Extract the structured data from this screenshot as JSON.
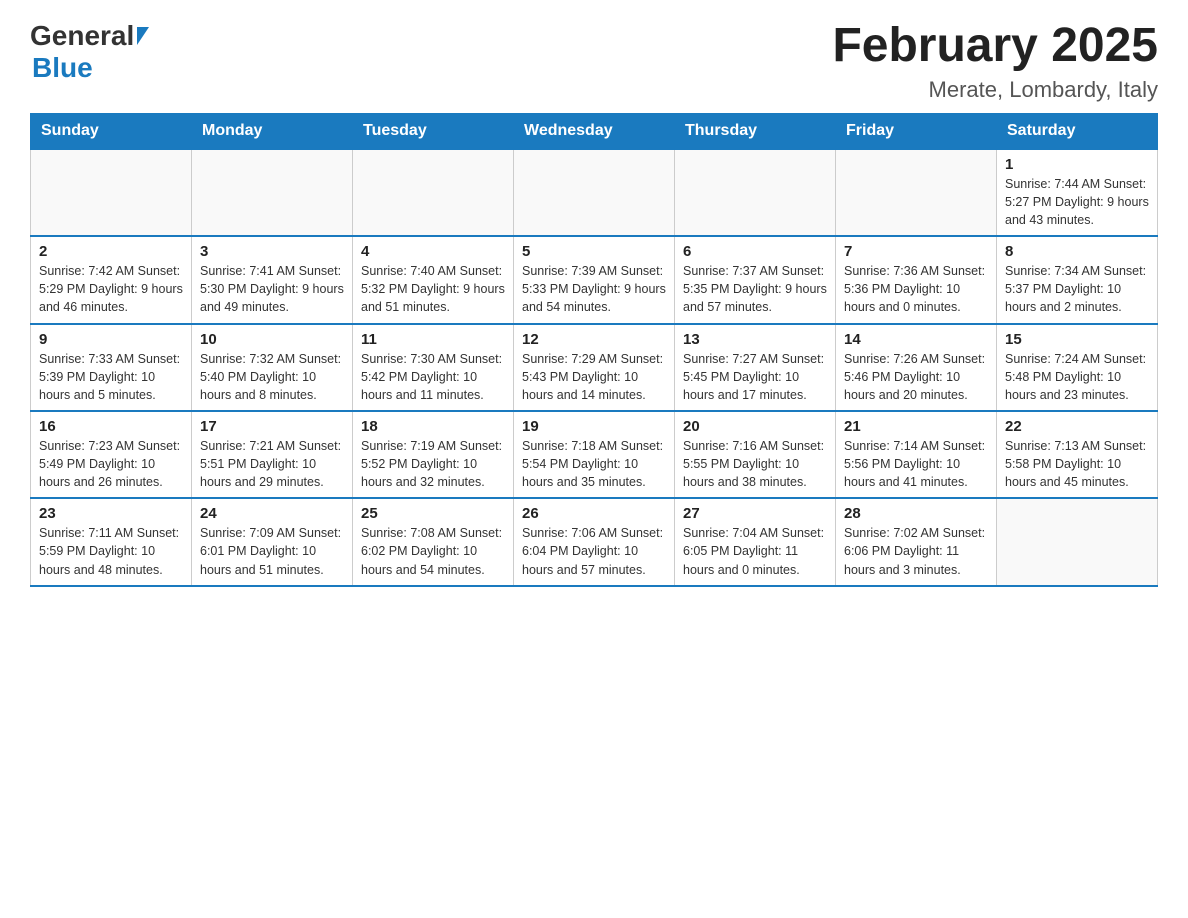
{
  "header": {
    "logo_general": "General",
    "logo_blue": "Blue",
    "title": "February 2025",
    "subtitle": "Merate, Lombardy, Italy"
  },
  "days_of_week": [
    "Sunday",
    "Monday",
    "Tuesday",
    "Wednesday",
    "Thursday",
    "Friday",
    "Saturday"
  ],
  "weeks": [
    {
      "days": [
        {
          "num": "",
          "info": "",
          "empty": true
        },
        {
          "num": "",
          "info": "",
          "empty": true
        },
        {
          "num": "",
          "info": "",
          "empty": true
        },
        {
          "num": "",
          "info": "",
          "empty": true
        },
        {
          "num": "",
          "info": "",
          "empty": true
        },
        {
          "num": "",
          "info": "",
          "empty": true
        },
        {
          "num": "1",
          "info": "Sunrise: 7:44 AM\nSunset: 5:27 PM\nDaylight: 9 hours\nand 43 minutes.",
          "empty": false
        }
      ]
    },
    {
      "days": [
        {
          "num": "2",
          "info": "Sunrise: 7:42 AM\nSunset: 5:29 PM\nDaylight: 9 hours\nand 46 minutes.",
          "empty": false
        },
        {
          "num": "3",
          "info": "Sunrise: 7:41 AM\nSunset: 5:30 PM\nDaylight: 9 hours\nand 49 minutes.",
          "empty": false
        },
        {
          "num": "4",
          "info": "Sunrise: 7:40 AM\nSunset: 5:32 PM\nDaylight: 9 hours\nand 51 minutes.",
          "empty": false
        },
        {
          "num": "5",
          "info": "Sunrise: 7:39 AM\nSunset: 5:33 PM\nDaylight: 9 hours\nand 54 minutes.",
          "empty": false
        },
        {
          "num": "6",
          "info": "Sunrise: 7:37 AM\nSunset: 5:35 PM\nDaylight: 9 hours\nand 57 minutes.",
          "empty": false
        },
        {
          "num": "7",
          "info": "Sunrise: 7:36 AM\nSunset: 5:36 PM\nDaylight: 10 hours\nand 0 minutes.",
          "empty": false
        },
        {
          "num": "8",
          "info": "Sunrise: 7:34 AM\nSunset: 5:37 PM\nDaylight: 10 hours\nand 2 minutes.",
          "empty": false
        }
      ]
    },
    {
      "days": [
        {
          "num": "9",
          "info": "Sunrise: 7:33 AM\nSunset: 5:39 PM\nDaylight: 10 hours\nand 5 minutes.",
          "empty": false
        },
        {
          "num": "10",
          "info": "Sunrise: 7:32 AM\nSunset: 5:40 PM\nDaylight: 10 hours\nand 8 minutes.",
          "empty": false
        },
        {
          "num": "11",
          "info": "Sunrise: 7:30 AM\nSunset: 5:42 PM\nDaylight: 10 hours\nand 11 minutes.",
          "empty": false
        },
        {
          "num": "12",
          "info": "Sunrise: 7:29 AM\nSunset: 5:43 PM\nDaylight: 10 hours\nand 14 minutes.",
          "empty": false
        },
        {
          "num": "13",
          "info": "Sunrise: 7:27 AM\nSunset: 5:45 PM\nDaylight: 10 hours\nand 17 minutes.",
          "empty": false
        },
        {
          "num": "14",
          "info": "Sunrise: 7:26 AM\nSunset: 5:46 PM\nDaylight: 10 hours\nand 20 minutes.",
          "empty": false
        },
        {
          "num": "15",
          "info": "Sunrise: 7:24 AM\nSunset: 5:48 PM\nDaylight: 10 hours\nand 23 minutes.",
          "empty": false
        }
      ]
    },
    {
      "days": [
        {
          "num": "16",
          "info": "Sunrise: 7:23 AM\nSunset: 5:49 PM\nDaylight: 10 hours\nand 26 minutes.",
          "empty": false
        },
        {
          "num": "17",
          "info": "Sunrise: 7:21 AM\nSunset: 5:51 PM\nDaylight: 10 hours\nand 29 minutes.",
          "empty": false
        },
        {
          "num": "18",
          "info": "Sunrise: 7:19 AM\nSunset: 5:52 PM\nDaylight: 10 hours\nand 32 minutes.",
          "empty": false
        },
        {
          "num": "19",
          "info": "Sunrise: 7:18 AM\nSunset: 5:54 PM\nDaylight: 10 hours\nand 35 minutes.",
          "empty": false
        },
        {
          "num": "20",
          "info": "Sunrise: 7:16 AM\nSunset: 5:55 PM\nDaylight: 10 hours\nand 38 minutes.",
          "empty": false
        },
        {
          "num": "21",
          "info": "Sunrise: 7:14 AM\nSunset: 5:56 PM\nDaylight: 10 hours\nand 41 minutes.",
          "empty": false
        },
        {
          "num": "22",
          "info": "Sunrise: 7:13 AM\nSunset: 5:58 PM\nDaylight: 10 hours\nand 45 minutes.",
          "empty": false
        }
      ]
    },
    {
      "days": [
        {
          "num": "23",
          "info": "Sunrise: 7:11 AM\nSunset: 5:59 PM\nDaylight: 10 hours\nand 48 minutes.",
          "empty": false
        },
        {
          "num": "24",
          "info": "Sunrise: 7:09 AM\nSunset: 6:01 PM\nDaylight: 10 hours\nand 51 minutes.",
          "empty": false
        },
        {
          "num": "25",
          "info": "Sunrise: 7:08 AM\nSunset: 6:02 PM\nDaylight: 10 hours\nand 54 minutes.",
          "empty": false
        },
        {
          "num": "26",
          "info": "Sunrise: 7:06 AM\nSunset: 6:04 PM\nDaylight: 10 hours\nand 57 minutes.",
          "empty": false
        },
        {
          "num": "27",
          "info": "Sunrise: 7:04 AM\nSunset: 6:05 PM\nDaylight: 11 hours\nand 0 minutes.",
          "empty": false
        },
        {
          "num": "28",
          "info": "Sunrise: 7:02 AM\nSunset: 6:06 PM\nDaylight: 11 hours\nand 3 minutes.",
          "empty": false
        },
        {
          "num": "",
          "info": "",
          "empty": true
        }
      ]
    }
  ]
}
